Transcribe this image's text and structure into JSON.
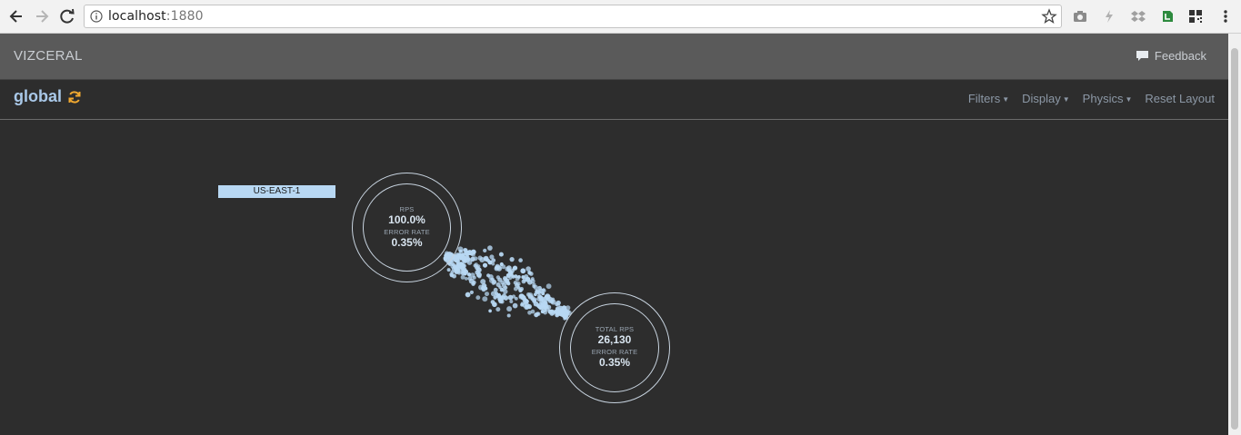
{
  "browser": {
    "url_host": "localhost",
    "url_port": ":1880"
  },
  "app": {
    "title": "VIZCERAL",
    "feedback_label": "Feedback"
  },
  "view": {
    "breadcrumb": "global",
    "menu": {
      "filters": "Filters",
      "display": "Display",
      "physics": "Physics",
      "reset_layout": "Reset Layout"
    }
  },
  "graph": {
    "region_label": "US-EAST-1",
    "source_node": {
      "metric1_label": "RPS",
      "metric1_value": "100.0%",
      "metric2_label": "ERROR RATE",
      "metric2_value": "0.35%"
    },
    "target_node": {
      "metric1_label": "TOTAL RPS",
      "metric1_value": "26,130",
      "metric2_label": "ERROR RATE",
      "metric2_value": "0.35%"
    },
    "particle_color": "#b8d8f3"
  },
  "colors": {
    "accent": "#a9c8e8",
    "refresh_icon": "#f0a830",
    "background": "#2d2d2d"
  }
}
